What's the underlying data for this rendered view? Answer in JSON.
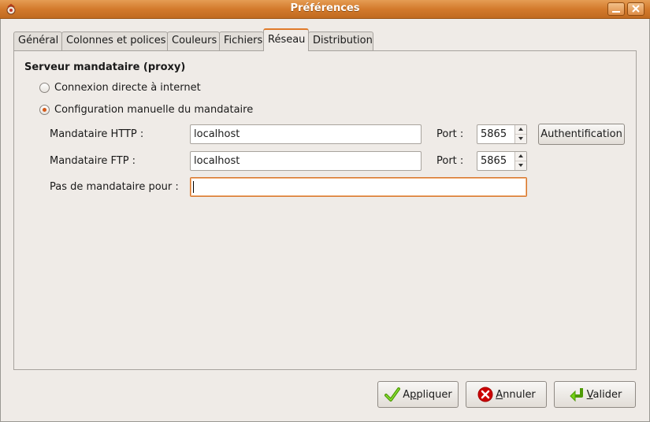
{
  "window": {
    "title": "Préférences"
  },
  "tabs": [
    {
      "label": "Général"
    },
    {
      "label": "Colonnes et polices"
    },
    {
      "label": "Couleurs"
    },
    {
      "label": "Fichiers"
    },
    {
      "label": "Réseau"
    },
    {
      "label": "Distribution"
    }
  ],
  "proxy": {
    "section_title": "Serveur mandataire (proxy)",
    "direct_label": "Connexion directe à internet",
    "manual_label": "Configuration manuelle du mandataire",
    "selected": "manual",
    "http_label": "Mandataire HTTP :",
    "http_value": "localhost",
    "http_port_label": "Port :",
    "http_port": "5865",
    "auth_button": "Authentification",
    "ftp_label": "Mandataire FTP :",
    "ftp_value": "localhost",
    "ftp_port_label": "Port :",
    "ftp_port": "5865",
    "no_proxy_label": "Pas de mandataire pour :",
    "no_proxy_value": ""
  },
  "buttons": {
    "apply_prefix": "A",
    "apply_mnemonic": "p",
    "apply_rest": "pliquer",
    "cancel_prefix": "",
    "cancel_mnemonic": "A",
    "cancel_rest": "nnuler",
    "ok_prefix": "",
    "ok_mnemonic": "V",
    "ok_rest": "alider"
  }
}
